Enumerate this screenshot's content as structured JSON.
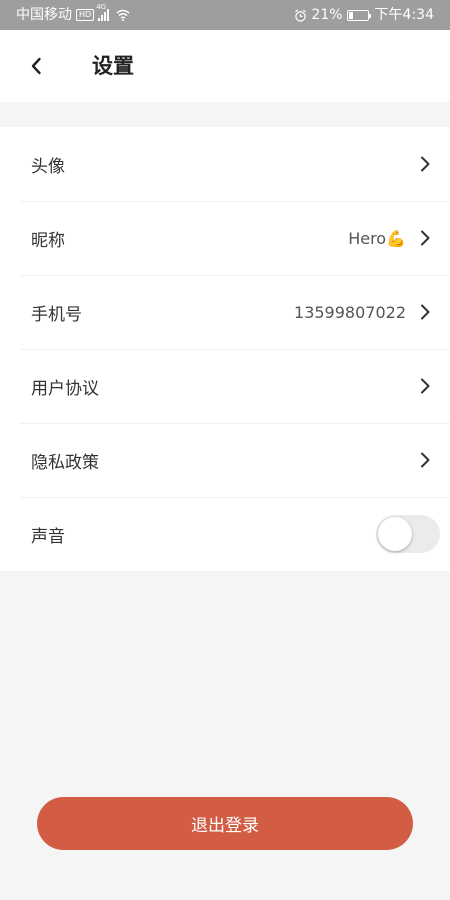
{
  "status_bar": {
    "carrier": "中国移动",
    "hd": "HD",
    "network": "4G",
    "battery_text": "21%",
    "battery_level": 0.21,
    "time": "下午4:34"
  },
  "header": {
    "title": "设置"
  },
  "settings": {
    "items": [
      {
        "label": "头像",
        "value": ""
      },
      {
        "label": "昵称",
        "value": "Hero💪"
      },
      {
        "label": "手机号",
        "value": "13599807022"
      },
      {
        "label": "用户协议",
        "value": ""
      },
      {
        "label": "隐私政策",
        "value": ""
      }
    ],
    "sound": {
      "label": "声音",
      "enabled": false
    }
  },
  "footer": {
    "logout_label": "退出登录"
  },
  "colors": {
    "accent": "#d35c45",
    "background": "#f5f5f5",
    "status_bar": "#9e9e9e"
  }
}
